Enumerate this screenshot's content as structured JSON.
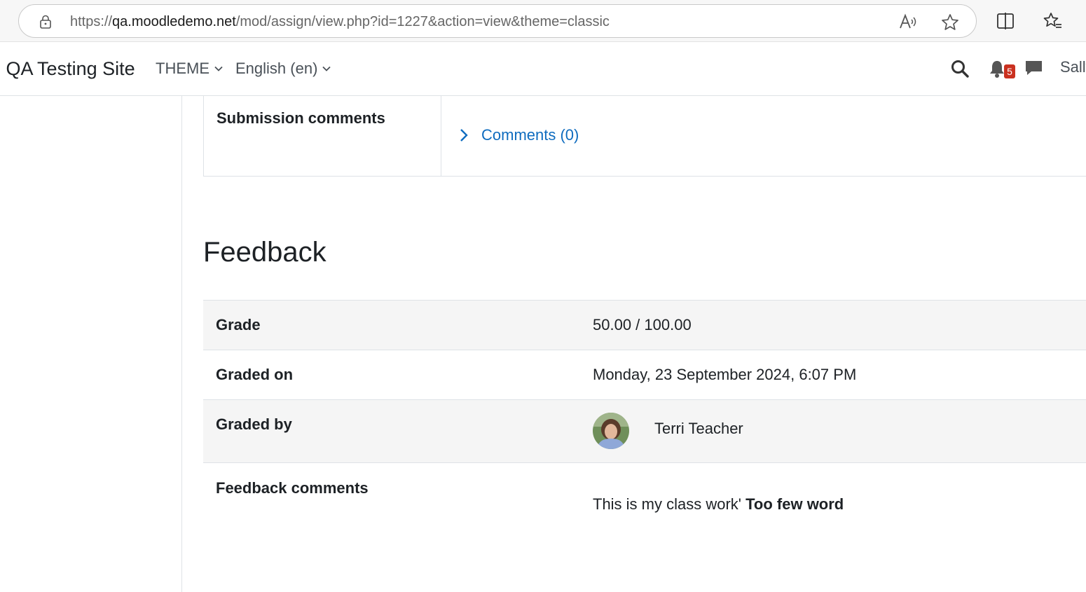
{
  "browser": {
    "url_prefix": "https://",
    "url_host": "qa.moodledemo.net",
    "url_path": "/mod/assign/view.php?id=1227&action=view&theme=classic"
  },
  "navbar": {
    "site_name": "e QA Testing Site",
    "menu_theme": "THEME",
    "menu_language": "English (en)",
    "notification_count": "5",
    "user_name": "Sally"
  },
  "submission": {
    "comments_label": "Submission comments",
    "comments_link": "Comments (0)"
  },
  "feedback": {
    "heading": "Feedback",
    "rows": [
      {
        "label": "Grade",
        "value": "50.00 / 100.00"
      },
      {
        "label": "Graded on",
        "value": "Monday, 23 September 2024, 6:07 PM"
      },
      {
        "label": "Graded by",
        "value": "Terri Teacher"
      },
      {
        "label": "Feedback comments",
        "value_plain": "This is my class work' ",
        "value_bold": "Too few word"
      }
    ]
  },
  "colors": {
    "link": "#0f6cbf",
    "badge": "#ca3120",
    "stripe": "#f5f5f5"
  }
}
